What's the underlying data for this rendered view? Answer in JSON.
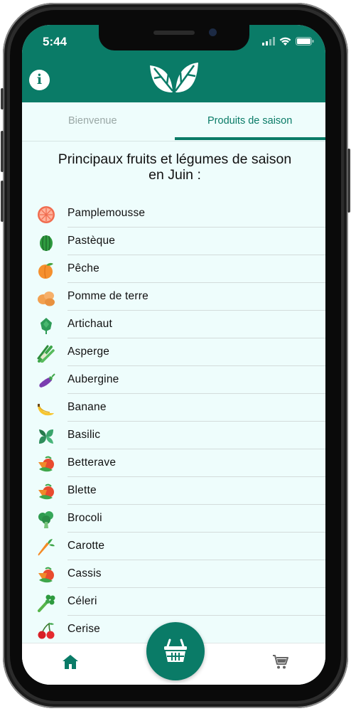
{
  "status_bar": {
    "time": "5:44"
  },
  "tabs": [
    {
      "label": "Bienvenue",
      "active": false
    },
    {
      "label": "Produits de saison",
      "active": true
    }
  ],
  "content": {
    "title_line1": "Principaux fruits et légumes de saison",
    "title_line2": "en Juin :"
  },
  "items": [
    {
      "label": "Pamplemousse",
      "icon": "grapefruit-icon"
    },
    {
      "label": "Pastèque",
      "icon": "watermelon-icon"
    },
    {
      "label": "Pêche",
      "icon": "peach-icon"
    },
    {
      "label": "Pomme de terre",
      "icon": "potato-icon"
    },
    {
      "label": "Artichaut",
      "icon": "artichoke-icon"
    },
    {
      "label": "Asperge",
      "icon": "asparagus-icon"
    },
    {
      "label": "Aubergine",
      "icon": "eggplant-icon"
    },
    {
      "label": "Banane",
      "icon": "banana-icon"
    },
    {
      "label": "Basilic",
      "icon": "basil-icon"
    },
    {
      "label": "Betterave",
      "icon": "vegetables-icon"
    },
    {
      "label": "Blette",
      "icon": "vegetables-icon"
    },
    {
      "label": "Brocoli",
      "icon": "broccoli-icon"
    },
    {
      "label": "Carotte",
      "icon": "carrot-icon"
    },
    {
      "label": "Cassis",
      "icon": "vegetables-icon"
    },
    {
      "label": "Céleri",
      "icon": "celery-icon"
    },
    {
      "label": "Cerise",
      "icon": "cherry-icon"
    }
  ],
  "colors": {
    "brand": "#0a7b67",
    "background": "#eefdfc",
    "inactive_tab": "#9aa8a6"
  },
  "bottom_nav": {
    "home_icon": "home-icon",
    "basket_icon": "basket-icon",
    "cart_icon": "cart-icon"
  }
}
